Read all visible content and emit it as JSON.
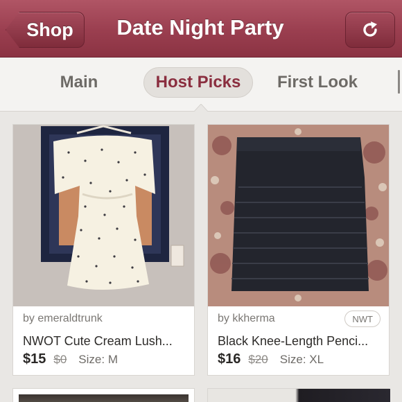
{
  "header": {
    "back_label": "Shop",
    "title": "Date Night Party",
    "refresh_icon": "refresh-icon",
    "color": "#9a3e4f"
  },
  "tabs": [
    {
      "label": "Main",
      "active": false
    },
    {
      "label": "Host Picks",
      "active": true
    },
    {
      "label": "First Look",
      "active": false
    }
  ],
  "accent": "#8a2e3f",
  "listings": [
    {
      "seller": "by emeraldtrunk",
      "title": "NWOT Cute Cream Lush...",
      "price": "$15",
      "original_price": "$0",
      "size": "Size: M",
      "badge": ""
    },
    {
      "seller": "by kkherma",
      "title": "Black Knee-Length Penci...",
      "price": "$16",
      "original_price": "$20",
      "size": "Size: XL",
      "badge": "NWT"
    }
  ]
}
